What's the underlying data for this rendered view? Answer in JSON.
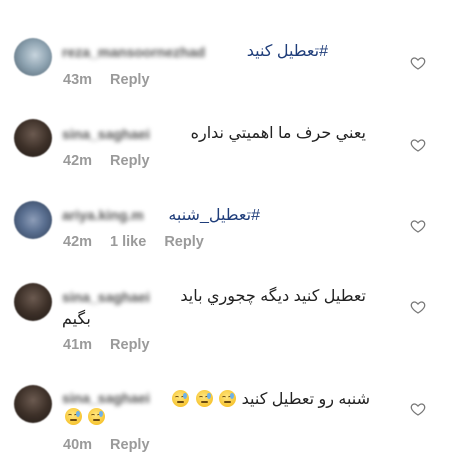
{
  "comments": [
    {
      "username": "reza_mansoornezhad",
      "text_plain": "تعطیل کنید",
      "text_tag": "#",
      "time": "43m",
      "likes": "",
      "reply": "Reply"
    },
    {
      "username": "sina_saghaei",
      "text_plain": "يعني حرف ما اهميتي نداره",
      "time": "42m",
      "likes": "",
      "reply": "Reply"
    },
    {
      "username": "ariya.king.m",
      "text_tag": "#تعطیل_شنبه",
      "time": "42m",
      "likes": "1 like",
      "reply": "Reply"
    },
    {
      "username": "sina_saghaei",
      "text_line1": "تعطيل كنيد ديگه چجوري بايد",
      "text_line2": "بگيم",
      "time": "41m",
      "likes": "",
      "reply": "Reply"
    },
    {
      "username": "sina_saghaei",
      "text_line1": "شنبه رو تعطيل كنيد",
      "time": "40m",
      "likes": "",
      "reply": "Reply"
    }
  ],
  "icons": {
    "heart": "heart-outline-icon",
    "emoji": "sad-sweat-emoji-icon"
  },
  "colors": {
    "hashtag": "#1f3d7a",
    "meta": "#9a9a9a",
    "text": "#222222"
  }
}
